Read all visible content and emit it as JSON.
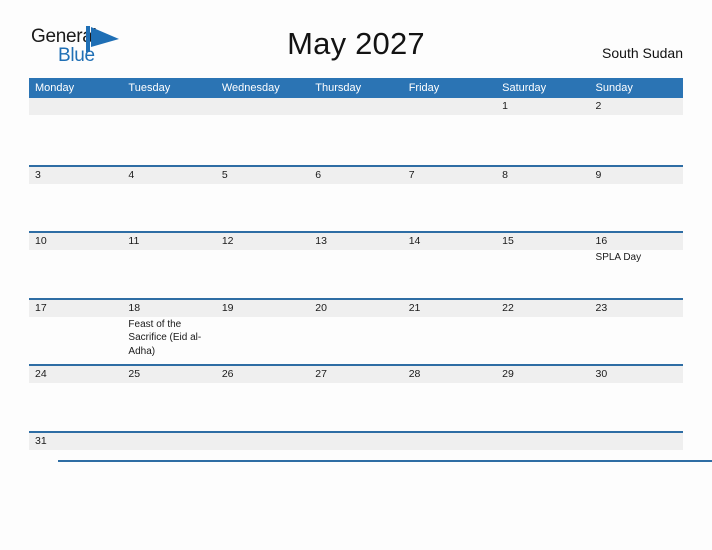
{
  "brand": {
    "name_part1": "General",
    "name_part2": "Blue",
    "mark_icon": "flag-triangle-icon",
    "accent_color": "#1f6fb5"
  },
  "header": {
    "title": "May 2027",
    "country": "South Sudan"
  },
  "colors": {
    "header_blue": "#2b74b4",
    "rule_blue": "#2e6da4",
    "daynum_band": "#efefef",
    "page_background": "#fdfdfd",
    "text": "#1a1a1a"
  },
  "calendar": {
    "weekday_headers": [
      "Monday",
      "Tuesday",
      "Wednesday",
      "Thursday",
      "Friday",
      "Saturday",
      "Sunday"
    ],
    "weeks": [
      {
        "days": [
          {
            "number": "",
            "events": []
          },
          {
            "number": "",
            "events": []
          },
          {
            "number": "",
            "events": []
          },
          {
            "number": "",
            "events": []
          },
          {
            "number": "",
            "events": []
          },
          {
            "number": "1",
            "events": []
          },
          {
            "number": "2",
            "events": []
          }
        ]
      },
      {
        "days": [
          {
            "number": "3",
            "events": []
          },
          {
            "number": "4",
            "events": []
          },
          {
            "number": "5",
            "events": []
          },
          {
            "number": "6",
            "events": []
          },
          {
            "number": "7",
            "events": []
          },
          {
            "number": "8",
            "events": []
          },
          {
            "number": "9",
            "events": []
          }
        ]
      },
      {
        "days": [
          {
            "number": "10",
            "events": []
          },
          {
            "number": "11",
            "events": []
          },
          {
            "number": "12",
            "events": []
          },
          {
            "number": "13",
            "events": []
          },
          {
            "number": "14",
            "events": []
          },
          {
            "number": "15",
            "events": []
          },
          {
            "number": "16",
            "events": [
              "SPLA Day"
            ]
          }
        ]
      },
      {
        "days": [
          {
            "number": "17",
            "events": []
          },
          {
            "number": "18",
            "events": [
              "Feast of the Sacrifice (Eid al-Adha)"
            ]
          },
          {
            "number": "19",
            "events": []
          },
          {
            "number": "20",
            "events": []
          },
          {
            "number": "21",
            "events": []
          },
          {
            "number": "22",
            "events": []
          },
          {
            "number": "23",
            "events": []
          }
        ]
      },
      {
        "days": [
          {
            "number": "24",
            "events": []
          },
          {
            "number": "25",
            "events": []
          },
          {
            "number": "26",
            "events": []
          },
          {
            "number": "27",
            "events": []
          },
          {
            "number": "28",
            "events": []
          },
          {
            "number": "29",
            "events": []
          },
          {
            "number": "30",
            "events": []
          }
        ]
      },
      {
        "days": [
          {
            "number": "31",
            "events": []
          },
          {
            "number": "",
            "events": []
          },
          {
            "number": "",
            "events": []
          },
          {
            "number": "",
            "events": []
          },
          {
            "number": "",
            "events": []
          },
          {
            "number": "",
            "events": []
          },
          {
            "number": "",
            "events": []
          }
        ]
      }
    ]
  }
}
